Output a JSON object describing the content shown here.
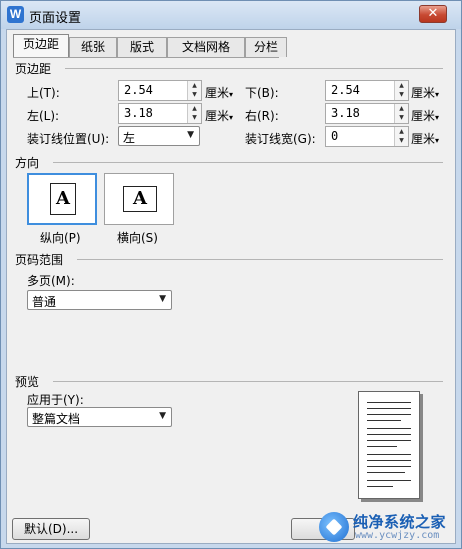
{
  "window": {
    "title": "页面设置",
    "app_icon": "W",
    "close_glyph": "✕"
  },
  "tabs": [
    {
      "label": "页边距",
      "active": true
    },
    {
      "label": "纸张",
      "active": false
    },
    {
      "label": "版式",
      "active": false
    },
    {
      "label": "文档网格",
      "active": false
    },
    {
      "label": "分栏",
      "active": false
    }
  ],
  "margins": {
    "section": "页边距",
    "top": {
      "label": "上(T):",
      "value": "2.54",
      "unit": "厘米"
    },
    "bottom": {
      "label": "下(B):",
      "value": "2.54",
      "unit": "厘米"
    },
    "left": {
      "label": "左(L):",
      "value": "3.18",
      "unit": "厘米"
    },
    "right": {
      "label": "右(R):",
      "value": "3.18",
      "unit": "厘米"
    },
    "gutter_pos": {
      "label": "装订线位置(U):",
      "value": "左"
    },
    "gutter": {
      "label": "装订线宽(G):",
      "value": "0",
      "unit": "厘米"
    }
  },
  "orientation": {
    "section": "方向",
    "portrait": {
      "label": "纵向(P)",
      "glyph": "A",
      "selected": true
    },
    "landscape": {
      "label": "横向(S)",
      "glyph": "A",
      "selected": false
    }
  },
  "pages": {
    "section": "页码范围",
    "multi_label": "多页(M):",
    "multi_value": "普通"
  },
  "preview": {
    "section": "预览",
    "apply_label": "应用于(Y):",
    "apply_value": "整篇文档"
  },
  "buttons": {
    "default": "默认(D)..."
  },
  "watermark": {
    "text": "纯净系统之家",
    "url": "www.ycwjzy.com"
  },
  "colors": {
    "selected_border": "#3e8ede",
    "close": "#c84a33",
    "brand": "#1a5fb4"
  }
}
